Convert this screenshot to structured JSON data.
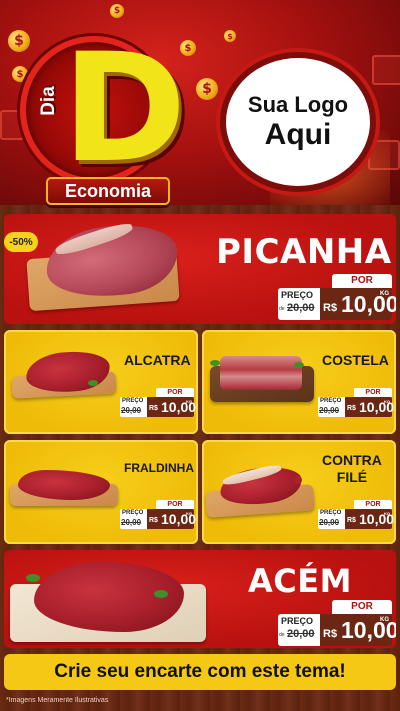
{
  "header": {
    "logo_dia": "Dia",
    "logo_letter": "D",
    "logo_banner": "Economia",
    "brand_line1": "Sua Logo",
    "brand_line2": "Aqui",
    "coin_symbol": "$"
  },
  "featured_top": {
    "name": "PICANHA",
    "discount": "-50%",
    "price": {
      "por": "POR",
      "preco": "PREÇO",
      "de": "de",
      "old": "20,00",
      "currency": "R$",
      "value": "10,00",
      "unit": "KG"
    }
  },
  "grid": [
    {
      "name": "ALCATRA",
      "price": {
        "por": "POR",
        "preco": "PREÇO",
        "old": "20,00",
        "currency": "R$",
        "value": "10,00",
        "unit": "KG"
      }
    },
    {
      "name": "COSTELA",
      "price": {
        "por": "POR",
        "preco": "PREÇO",
        "old": "20,00",
        "currency": "R$",
        "value": "10,00",
        "unit": "KG"
      }
    },
    {
      "name": "FRALDINHA",
      "price": {
        "por": "POR",
        "preco": "PREÇO",
        "old": "20,00",
        "currency": "R$",
        "value": "10,00",
        "unit": "KG"
      }
    },
    {
      "name_line1": "CONTRA",
      "name_line2": "FILÉ",
      "price": {
        "por": "POR",
        "preco": "PREÇO",
        "old": "20,00",
        "currency": "R$",
        "value": "10,00",
        "unit": "KG"
      }
    }
  ],
  "featured_bottom": {
    "name": "ACÉM",
    "price": {
      "por": "POR",
      "preco": "PREÇO",
      "de": "de",
      "old": "20,00",
      "currency": "R$",
      "value": "10,00",
      "unit": "KG"
    }
  },
  "footer": {
    "cta": "Crie seu encarte com este tema!",
    "note": "*Imagens Meramente Ilustrativas"
  },
  "colors": {
    "red": "#c8180f",
    "yellow": "#f4c814",
    "wood": "#6b2a12",
    "price_dark": "#6b2713"
  }
}
